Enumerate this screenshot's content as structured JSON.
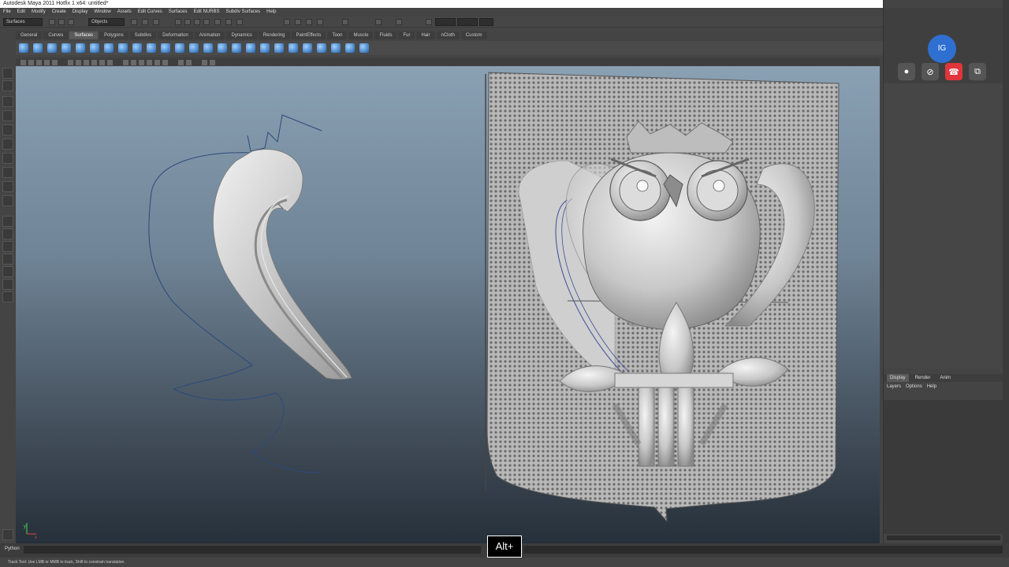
{
  "window": {
    "title": "Autodesk Maya 2011 Hotfix 1 x64: untitled*"
  },
  "menubar": {
    "items": [
      "File",
      "Edit",
      "Modify",
      "Create",
      "Display",
      "Window",
      "Assets",
      "Edit Curves",
      "Surfaces",
      "Edit NURBS",
      "Subdiv Surfaces",
      "Help"
    ]
  },
  "statusline": {
    "menuset": "Surfaces",
    "objects": "Objects"
  },
  "shelf": {
    "tabs": [
      "General",
      "Curves",
      "Surfaces",
      "Polygons",
      "Subdivs",
      "Deformation",
      "Animation",
      "Dynamics",
      "Rendering",
      "PaintEffects",
      "Toon",
      "Muscle",
      "Fluids",
      "Fur",
      "Hair",
      "nCloth",
      "Custom"
    ],
    "active": "Surfaces"
  },
  "call": {
    "initials": "IG",
    "mic_icon": "microphone-icon",
    "video_icon": "video-off-icon",
    "hangup_icon": "phone-hangup-icon",
    "popout_icon": "popout-icon",
    "hangup_color": "#e0353b",
    "avatar_color": "#2f6fd1"
  },
  "channelbox": {
    "tabs": [
      "Display",
      "Render",
      "Anim"
    ],
    "subtabs": [
      "Layers",
      "Options",
      "Help"
    ]
  },
  "cmdline": {
    "label": "Python"
  },
  "helpline": {
    "text": "Track Tool: Use LMB or MMB to track, Shift to constrain translation."
  },
  "overlay": {
    "key_hint": "Alt+"
  },
  "viewport": {
    "axis_x": "x",
    "axis_y": "y"
  }
}
